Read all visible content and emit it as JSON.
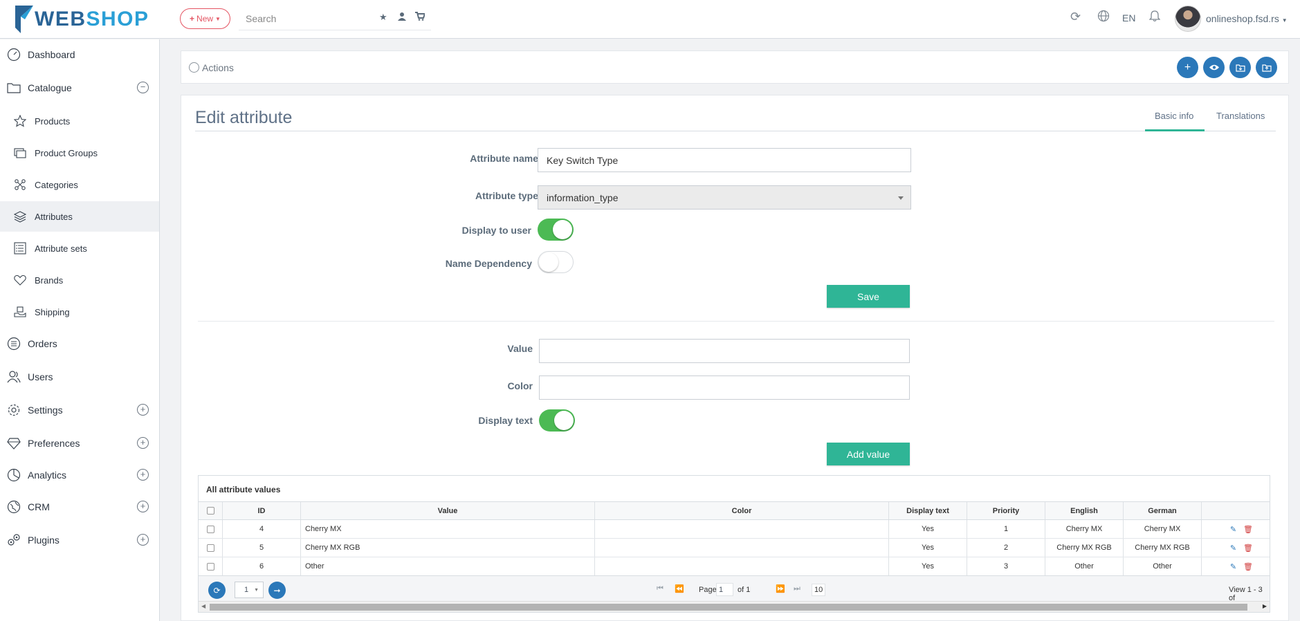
{
  "header": {
    "logo_web": "WEB",
    "logo_shop": "SHOP",
    "new_label": "New",
    "search_placeholder": "Search",
    "language": "EN",
    "user_name": "onlineshop.fsd.rs"
  },
  "sidebar": {
    "items": [
      {
        "label": "Dashboard",
        "icon": "dashboard-icon"
      },
      {
        "label": "Catalogue",
        "icon": "folder-icon",
        "expanded": true
      },
      {
        "label": "Products",
        "icon": "star-icon"
      },
      {
        "label": "Product Groups",
        "icon": "product-groups-icon"
      },
      {
        "label": "Categories",
        "icon": "categories-icon"
      },
      {
        "label": "Attributes",
        "icon": "layers-icon",
        "active": true
      },
      {
        "label": "Attribute sets",
        "icon": "list-icon"
      },
      {
        "label": "Brands",
        "icon": "heart-icon"
      },
      {
        "label": "Shipping",
        "icon": "shipping-icon"
      },
      {
        "label": "Orders",
        "icon": "orders-icon"
      },
      {
        "label": "Users",
        "icon": "users-icon"
      },
      {
        "label": "Settings",
        "icon": "gear-icon"
      },
      {
        "label": "Preferences",
        "icon": "diamond-icon"
      },
      {
        "label": "Analytics",
        "icon": "pie-chart-icon"
      },
      {
        "label": "CRM",
        "icon": "crm-icon"
      },
      {
        "label": "Plugins",
        "icon": "plugins-icon"
      }
    ]
  },
  "actions": {
    "label": "Actions"
  },
  "page": {
    "title": "Edit attribute",
    "tabs": [
      {
        "label": "Basic info",
        "active": true
      },
      {
        "label": "Translations",
        "active": false
      }
    ]
  },
  "form": {
    "attribute_name_label": "Attribute name",
    "attribute_name_value": "Key Switch Type",
    "attribute_type_label": "Attribute type",
    "attribute_type_value": "information_type",
    "display_to_user_label": "Display to user",
    "display_to_user": true,
    "name_dependency_label": "Name Dependency",
    "name_dependency": false,
    "save_label": "Save"
  },
  "value_form": {
    "value_label": "Value",
    "value_value": "",
    "color_label": "Color",
    "color_value": "",
    "display_text_label": "Display text",
    "display_text": true,
    "add_label": "Add value"
  },
  "grid": {
    "caption": "All attribute values",
    "columns": [
      "ID",
      "Value",
      "Color",
      "Display text",
      "Priority",
      "English",
      "German"
    ],
    "rows": [
      {
        "id": "4",
        "value": "Cherry MX",
        "color": "",
        "display_text": "Yes",
        "priority": "1",
        "english": "Cherry MX",
        "german": "Cherry MX"
      },
      {
        "id": "5",
        "value": "Cherry MX RGB",
        "color": "",
        "display_text": "Yes",
        "priority": "2",
        "english": "Cherry MX RGB",
        "german": "Cherry MX RGB"
      },
      {
        "id": "6",
        "value": "Other",
        "color": "",
        "display_text": "Yes",
        "priority": "3",
        "english": "Other",
        "german": "Other"
      }
    ],
    "pager": {
      "page_size_select": "1",
      "page_label": "Page",
      "page_value": "1",
      "of_label": "of 1",
      "rows_per_page": "10",
      "view_text": "View 1 - 3 of"
    }
  },
  "colors": {
    "accent_green": "#2fb596",
    "primary_blue": "#2b78b9",
    "toggle_on": "#4cba54",
    "new_red": "#e45462"
  }
}
